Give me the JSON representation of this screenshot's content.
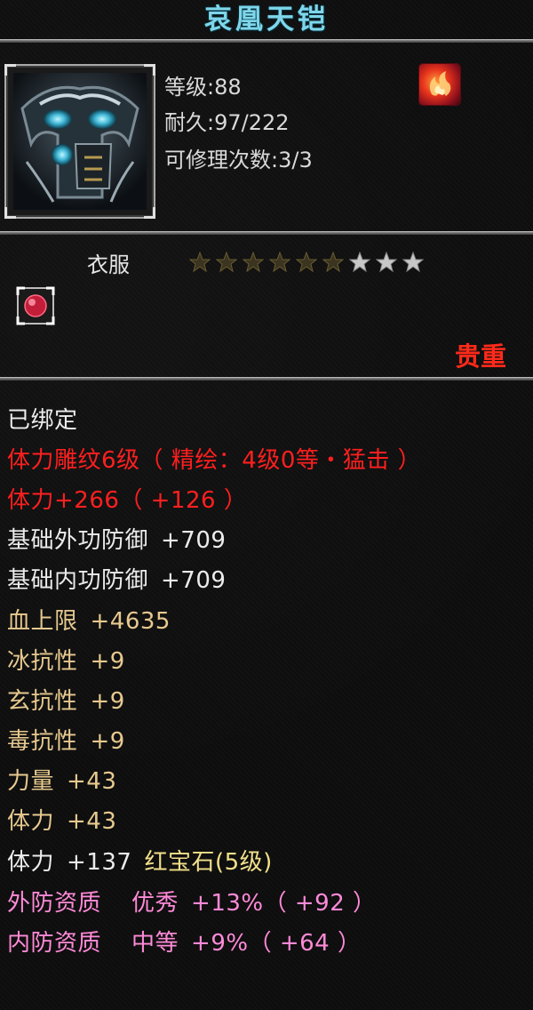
{
  "item": {
    "name": "哀凰天铠",
    "level_text": "等级:88",
    "durability_text": "耐久:97/222",
    "repair_text": "可修理次数:3/3",
    "type": "衣服",
    "stars_total": 9,
    "stars_filled": 6,
    "rarity": "贵重"
  },
  "icons": {
    "item_image": "armor-chest-icon",
    "buff": "flame-buff-icon",
    "socket": "ruby-socket-icon",
    "star": "star-icon"
  },
  "colors": {
    "title": "#7fd6ea",
    "rarity": "#ff2a1a",
    "bound": "#ececec",
    "engrave": "#ff1f1f",
    "base_stat": "#e7c98f",
    "gem_stat": "#f2e08a",
    "quality": "#ff8ad8"
  },
  "attributes": {
    "bound": "已绑定",
    "engrave": "体力雕纹6级（ 精绘：4级0等・猛击 ）",
    "engrave_bonus": "体力+266（ +126 ）",
    "outer_def": {
      "label": "基础外功防御",
      "value": "+709"
    },
    "inner_def": {
      "label": "基础内功防御",
      "value": "+709"
    },
    "hp_max": {
      "label": "血上限",
      "value": "+4635"
    },
    "ice_res": {
      "label": "冰抗性",
      "value": "+9"
    },
    "mystic_res": {
      "label": "玄抗性",
      "value": "+9"
    },
    "poison_res": {
      "label": "毒抗性",
      "value": "+9"
    },
    "strength": {
      "label": "力量",
      "value": "+43"
    },
    "stamina": {
      "label": "体力",
      "value": "+43"
    },
    "gem": {
      "label": "体力",
      "value": "+137",
      "gem_name": "红宝石(5级)"
    },
    "outer_quality": {
      "label": "外防资质",
      "grade": "优秀",
      "value": "+13%（ +92 ）"
    },
    "inner_quality": {
      "label": "内防资质",
      "grade": "中等",
      "value": "+9%（ +64 ）"
    }
  }
}
